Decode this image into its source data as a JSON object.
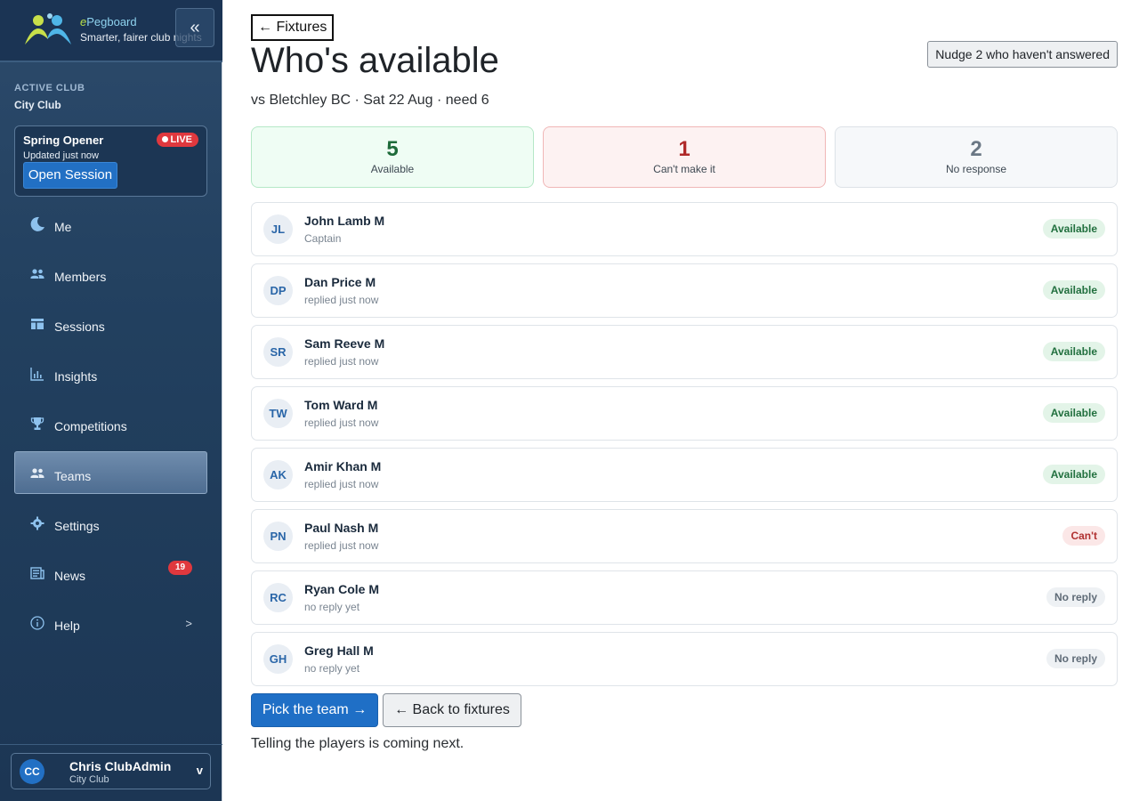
{
  "brand": {
    "name_prefix": "e",
    "name_rest": "Pegboard",
    "tagline": "Smarter, fairer club nights",
    "collapse_icon": "double-chevron-left-icon",
    "collapse_label": "«"
  },
  "club": {
    "label": "ACTIVE CLUB",
    "name": "City Club"
  },
  "session": {
    "title": "Spring Opener",
    "live": "LIVE",
    "updated": "Updated just now",
    "open_label": "Open Session"
  },
  "nav": {
    "items": [
      {
        "label": "Me",
        "icon": "moon-icon"
      },
      {
        "label": "Members",
        "icon": "people-icon"
      },
      {
        "label": "Sessions",
        "icon": "layout-icon"
      },
      {
        "label": "Insights",
        "icon": "bar-chart-icon"
      },
      {
        "label": "Competitions",
        "icon": "trophy-icon"
      },
      {
        "label": "Teams",
        "icon": "people-icon",
        "active": true
      },
      {
        "label": "Settings",
        "icon": "gear-icon"
      },
      {
        "label": "News",
        "icon": "newspaper-icon",
        "badge": "19"
      },
      {
        "label": "Help",
        "icon": "info-icon",
        "chevron": ">"
      }
    ]
  },
  "user": {
    "initials": "CC",
    "name": "Chris ClubAdmin",
    "club": "City Club",
    "chevron": "v"
  },
  "page": {
    "back_link": "← Fixtures",
    "title": "Who's available",
    "subtitle": "vs Bletchley BC · Sat 22 Aug · need 6",
    "nudge_label": "Nudge 2 who haven't answered"
  },
  "stats": {
    "available": {
      "value": "5",
      "label": "Available"
    },
    "cant": {
      "value": "1",
      "label": "Can't make it"
    },
    "none": {
      "value": "2",
      "label": "No response"
    }
  },
  "players": [
    {
      "initials": "JL",
      "name": "John Lamb M",
      "note": "Captain",
      "status": "Available",
      "kind": "available"
    },
    {
      "initials": "DP",
      "name": "Dan Price M",
      "note": "replied just now",
      "status": "Available",
      "kind": "available"
    },
    {
      "initials": "SR",
      "name": "Sam Reeve M",
      "note": "replied just now",
      "status": "Available",
      "kind": "available"
    },
    {
      "initials": "TW",
      "name": "Tom Ward M",
      "note": "replied just now",
      "status": "Available",
      "kind": "available"
    },
    {
      "initials": "AK",
      "name": "Amir Khan M",
      "note": "replied just now",
      "status": "Available",
      "kind": "available"
    },
    {
      "initials": "PN",
      "name": "Paul Nash M",
      "note": "replied just now",
      "status": "Can't",
      "kind": "cant"
    },
    {
      "initials": "RC",
      "name": "Ryan Cole M",
      "note": "no reply yet",
      "status": "No reply",
      "kind": "noreply"
    },
    {
      "initials": "GH",
      "name": "Greg Hall M",
      "note": "no reply yet",
      "status": "No reply",
      "kind": "noreply"
    }
  ],
  "actions": {
    "pick_label": "Pick the team →",
    "back_label": "← Back to fixtures",
    "footnote": "Telling the players is coming next."
  },
  "colors": {
    "sidebar_bg": "#22405f",
    "accent": "#1f6fc6",
    "live": "#e0383e",
    "available": "#22703f",
    "cant": "#b03030",
    "noreply": "#5f6b77"
  }
}
